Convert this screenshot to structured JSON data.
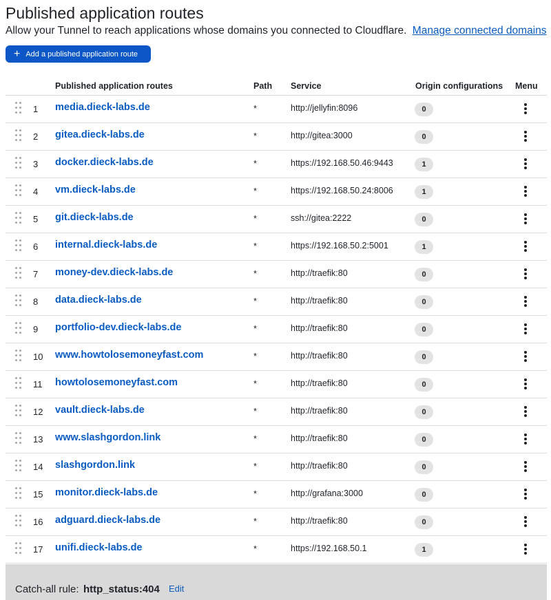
{
  "header": {
    "title": "Published application routes",
    "subtitle": "Allow your Tunnel to reach applications whose domains you connected to Cloudflare.",
    "manage_link": "Manage connected domains"
  },
  "toolbar": {
    "add_label": "Add a published application route"
  },
  "table": {
    "columns": [
      "Published application routes",
      "Path",
      "Service",
      "Origin configurations",
      "Menu"
    ],
    "rows": [
      {
        "num": "1",
        "host": "media.dieck-labs.de",
        "path": "*",
        "service": "http://jellyfin:8096",
        "origins": "0"
      },
      {
        "num": "2",
        "host": "gitea.dieck-labs.de",
        "path": "*",
        "service": "http://gitea:3000",
        "origins": "0"
      },
      {
        "num": "3",
        "host": "docker.dieck-labs.de",
        "path": "*",
        "service": "https://192.168.50.46:9443",
        "origins": "1"
      },
      {
        "num": "4",
        "host": "vm.dieck-labs.de",
        "path": "*",
        "service": "https://192.168.50.24:8006",
        "origins": "1"
      },
      {
        "num": "5",
        "host": "git.dieck-labs.de",
        "path": "*",
        "service": "ssh://gitea:2222",
        "origins": "0"
      },
      {
        "num": "6",
        "host": "internal.dieck-labs.de",
        "path": "*",
        "service": "https://192.168.50.2:5001",
        "origins": "1"
      },
      {
        "num": "7",
        "host": "money-dev.dieck-labs.de",
        "path": "*",
        "service": "http://traefik:80",
        "origins": "0"
      },
      {
        "num": "8",
        "host": "data.dieck-labs.de",
        "path": "*",
        "service": "http://traefik:80",
        "origins": "0"
      },
      {
        "num": "9",
        "host": "portfolio-dev.dieck-labs.de",
        "path": "*",
        "service": "http://traefik:80",
        "origins": "0"
      },
      {
        "num": "10",
        "host": "www.howtolosemoneyfast.com",
        "path": "*",
        "service": "http://traefik:80",
        "origins": "0"
      },
      {
        "num": "11",
        "host": "howtolosemoneyfast.com",
        "path": "*",
        "service": "http://traefik:80",
        "origins": "0"
      },
      {
        "num": "12",
        "host": "vault.dieck-labs.de",
        "path": "*",
        "service": "http://traefik:80",
        "origins": "0"
      },
      {
        "num": "13",
        "host": "www.slashgordon.link",
        "path": "*",
        "service": "http://traefik:80",
        "origins": "0"
      },
      {
        "num": "14",
        "host": "slashgordon.link",
        "path": "*",
        "service": "http://traefik:80",
        "origins": "0"
      },
      {
        "num": "15",
        "host": "monitor.dieck-labs.de",
        "path": "*",
        "service": "http://grafana:3000",
        "origins": "0"
      },
      {
        "num": "16",
        "host": "adguard.dieck-labs.de",
        "path": "*",
        "service": "http://traefik:80",
        "origins": "0"
      },
      {
        "num": "17",
        "host": "unifi.dieck-labs.de",
        "path": "*",
        "service": "https://192.168.50.1",
        "origins": "1"
      }
    ]
  },
  "catch_all": {
    "label": "Catch-all rule:",
    "value": "http_status:404",
    "edit_label": "Edit"
  },
  "icons": {
    "add": "plus-icon",
    "external": "external-link-icon",
    "drag": "drag-handle-icon",
    "menu": "kebab-menu-icon"
  },
  "colors": {
    "accent": "#0b57c8",
    "link": "#0b5cc2",
    "badge_bg": "#e3e3e3",
    "catch_all_bg": "#d9d9d9"
  }
}
